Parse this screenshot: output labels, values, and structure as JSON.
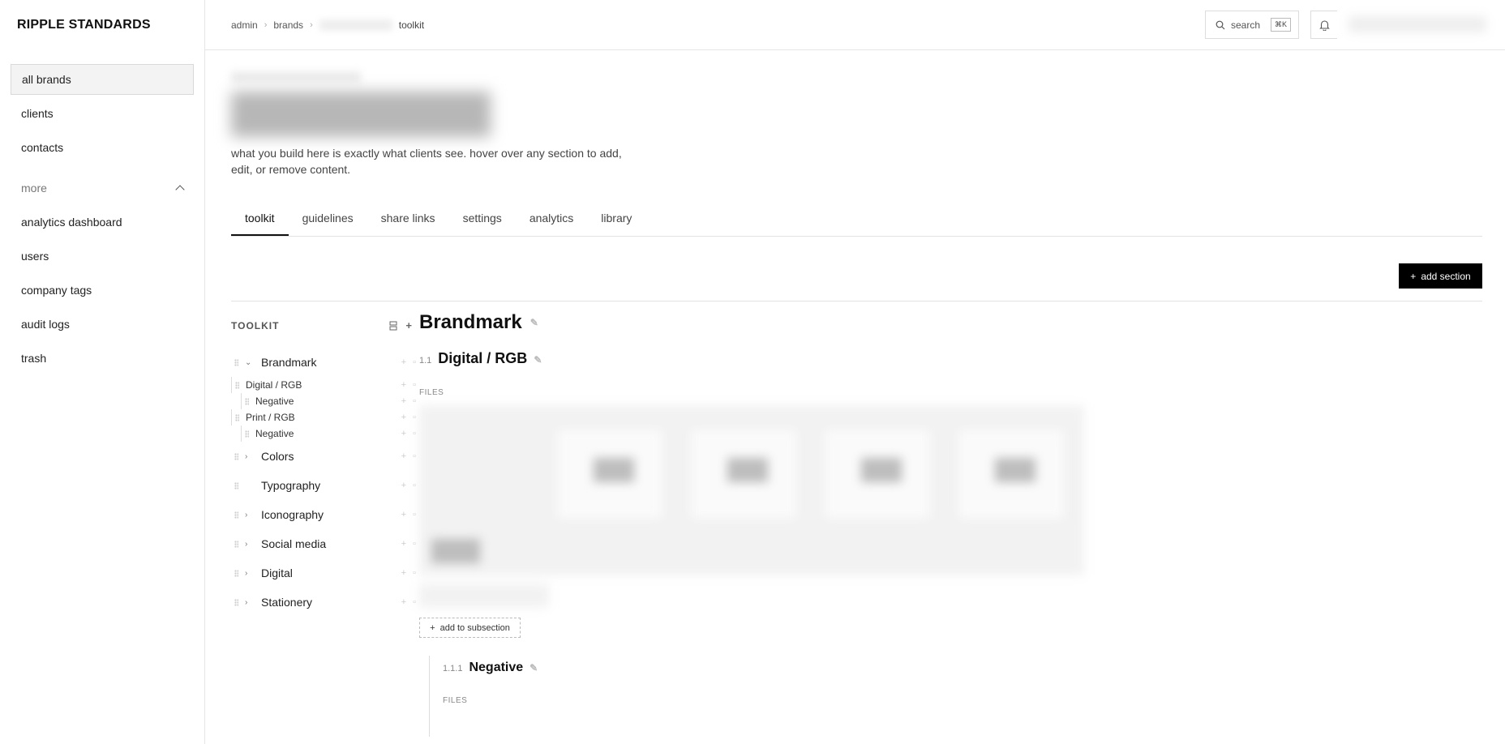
{
  "app": {
    "title": "RIPPLE STANDARDS"
  },
  "sidebar": {
    "items": [
      {
        "label": "all brands",
        "active": true
      },
      {
        "label": "clients"
      },
      {
        "label": "contacts"
      }
    ],
    "more_label": "more",
    "more_items": [
      {
        "label": "analytics dashboard"
      },
      {
        "label": "users"
      },
      {
        "label": "company tags"
      },
      {
        "label": "audit logs"
      },
      {
        "label": "trash"
      }
    ]
  },
  "topbar": {
    "breadcrumb": [
      "admin",
      "brands",
      "toolkit"
    ],
    "search_label": "search",
    "search_shortcut": "⌘K"
  },
  "page": {
    "description": "what you build here is exactly what clients see. hover over any section to add, edit, or remove content."
  },
  "tabs": [
    {
      "label": "toolkit",
      "active": true
    },
    {
      "label": "guidelines"
    },
    {
      "label": "share links"
    },
    {
      "label": "settings"
    },
    {
      "label": "analytics"
    },
    {
      "label": "library"
    }
  ],
  "actions": {
    "add_section": "add section"
  },
  "toolkit": {
    "heading": "TOOLKIT",
    "tree": {
      "brandmark": "Brandmark",
      "digital_rgb": "Digital / RGB",
      "negative_1": "Negative",
      "print_rgb": "Print / RGB",
      "negative_2": "Negative",
      "colors": "Colors",
      "typography": "Typography",
      "iconography": "Iconography",
      "social_media": "Social media",
      "digital": "Digital",
      "stationery": "Stationery"
    }
  },
  "detail": {
    "section_title": "Brandmark",
    "subsection_number": "1.1",
    "subsection_title": "Digital / RGB",
    "files_label": "FILES",
    "add_to_subsection": "add to subsection",
    "nested_number": "1.1.1",
    "nested_title": "Negative",
    "nested_files_label": "FILES"
  }
}
